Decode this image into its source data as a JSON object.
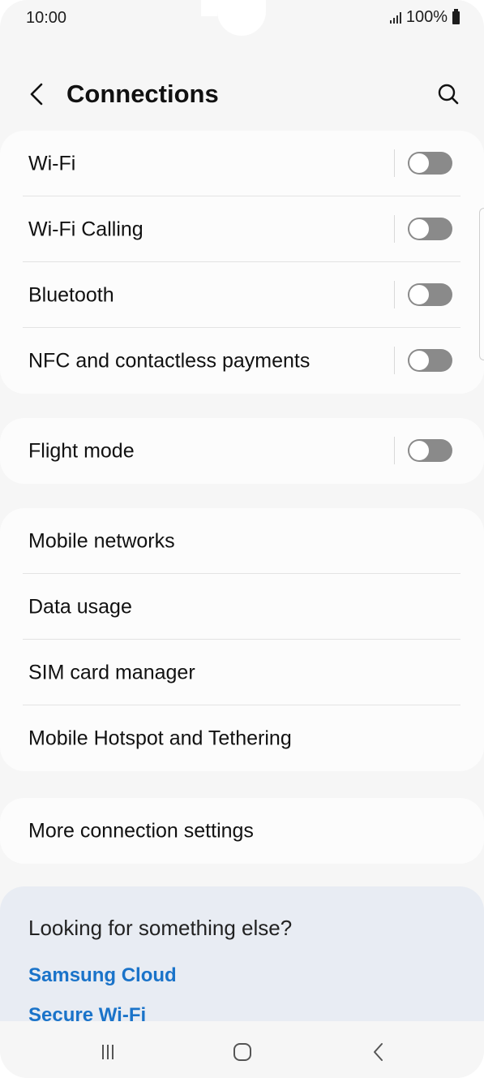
{
  "status": {
    "time": "10:00",
    "battery": "100%"
  },
  "header": {
    "title": "Connections"
  },
  "group1": [
    {
      "label": "Wi-Fi",
      "toggle": "off"
    },
    {
      "label": "Wi-Fi Calling",
      "toggle": "off"
    },
    {
      "label": "Bluetooth",
      "toggle": "off"
    },
    {
      "label": "NFC and contactless payments",
      "toggle": "off"
    }
  ],
  "group2": [
    {
      "label": "Flight mode",
      "toggle": "off"
    }
  ],
  "group3": [
    {
      "label": "Mobile networks"
    },
    {
      "label": "Data usage"
    },
    {
      "label": "SIM card manager"
    },
    {
      "label": "Mobile Hotspot and Tethering"
    }
  ],
  "group4": [
    {
      "label": "More connection settings"
    }
  ],
  "suggestions": {
    "title": "Looking for something else?",
    "links": [
      "Samsung Cloud",
      "Secure Wi-Fi"
    ]
  },
  "colors": {
    "accent": "#1a73c9",
    "toggle_off": "#8a8a8a",
    "background": "#f6f6f6"
  }
}
